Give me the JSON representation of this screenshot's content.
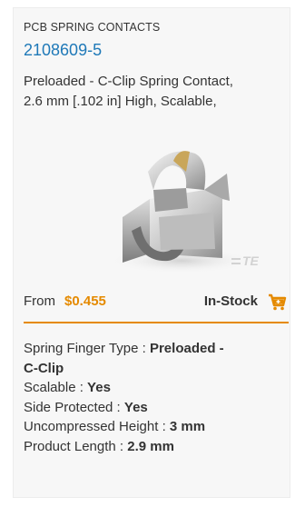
{
  "product": {
    "category": "PCB SPRING CONTACTS",
    "part_number": "2108609-5",
    "description_line1": "Preloaded - C-Clip Spring Contact,",
    "description_line2": "2.6 mm [.102 in] High, Scalable,",
    "image_watermark": "TE"
  },
  "pricing": {
    "from_label": "From",
    "price": "$0.455",
    "stock_status": "In-Stock",
    "cart_icon": "cart-plus-icon"
  },
  "specs": [
    {
      "label": "Spring Finger Type : ",
      "value_line1": "Preloaded -",
      "value_line2": "C-Clip"
    },
    {
      "label": "Scalable : ",
      "value": "Yes"
    },
    {
      "label": "Side Protected : ",
      "value": "Yes"
    },
    {
      "label": "Uncompressed Height : ",
      "value": "3 mm"
    },
    {
      "label": "Product Length : ",
      "value": "2.9 mm"
    }
  ],
  "colors": {
    "accent": "#e58a00",
    "link": "#1f79b8",
    "card_background": "#f7f7f7"
  }
}
